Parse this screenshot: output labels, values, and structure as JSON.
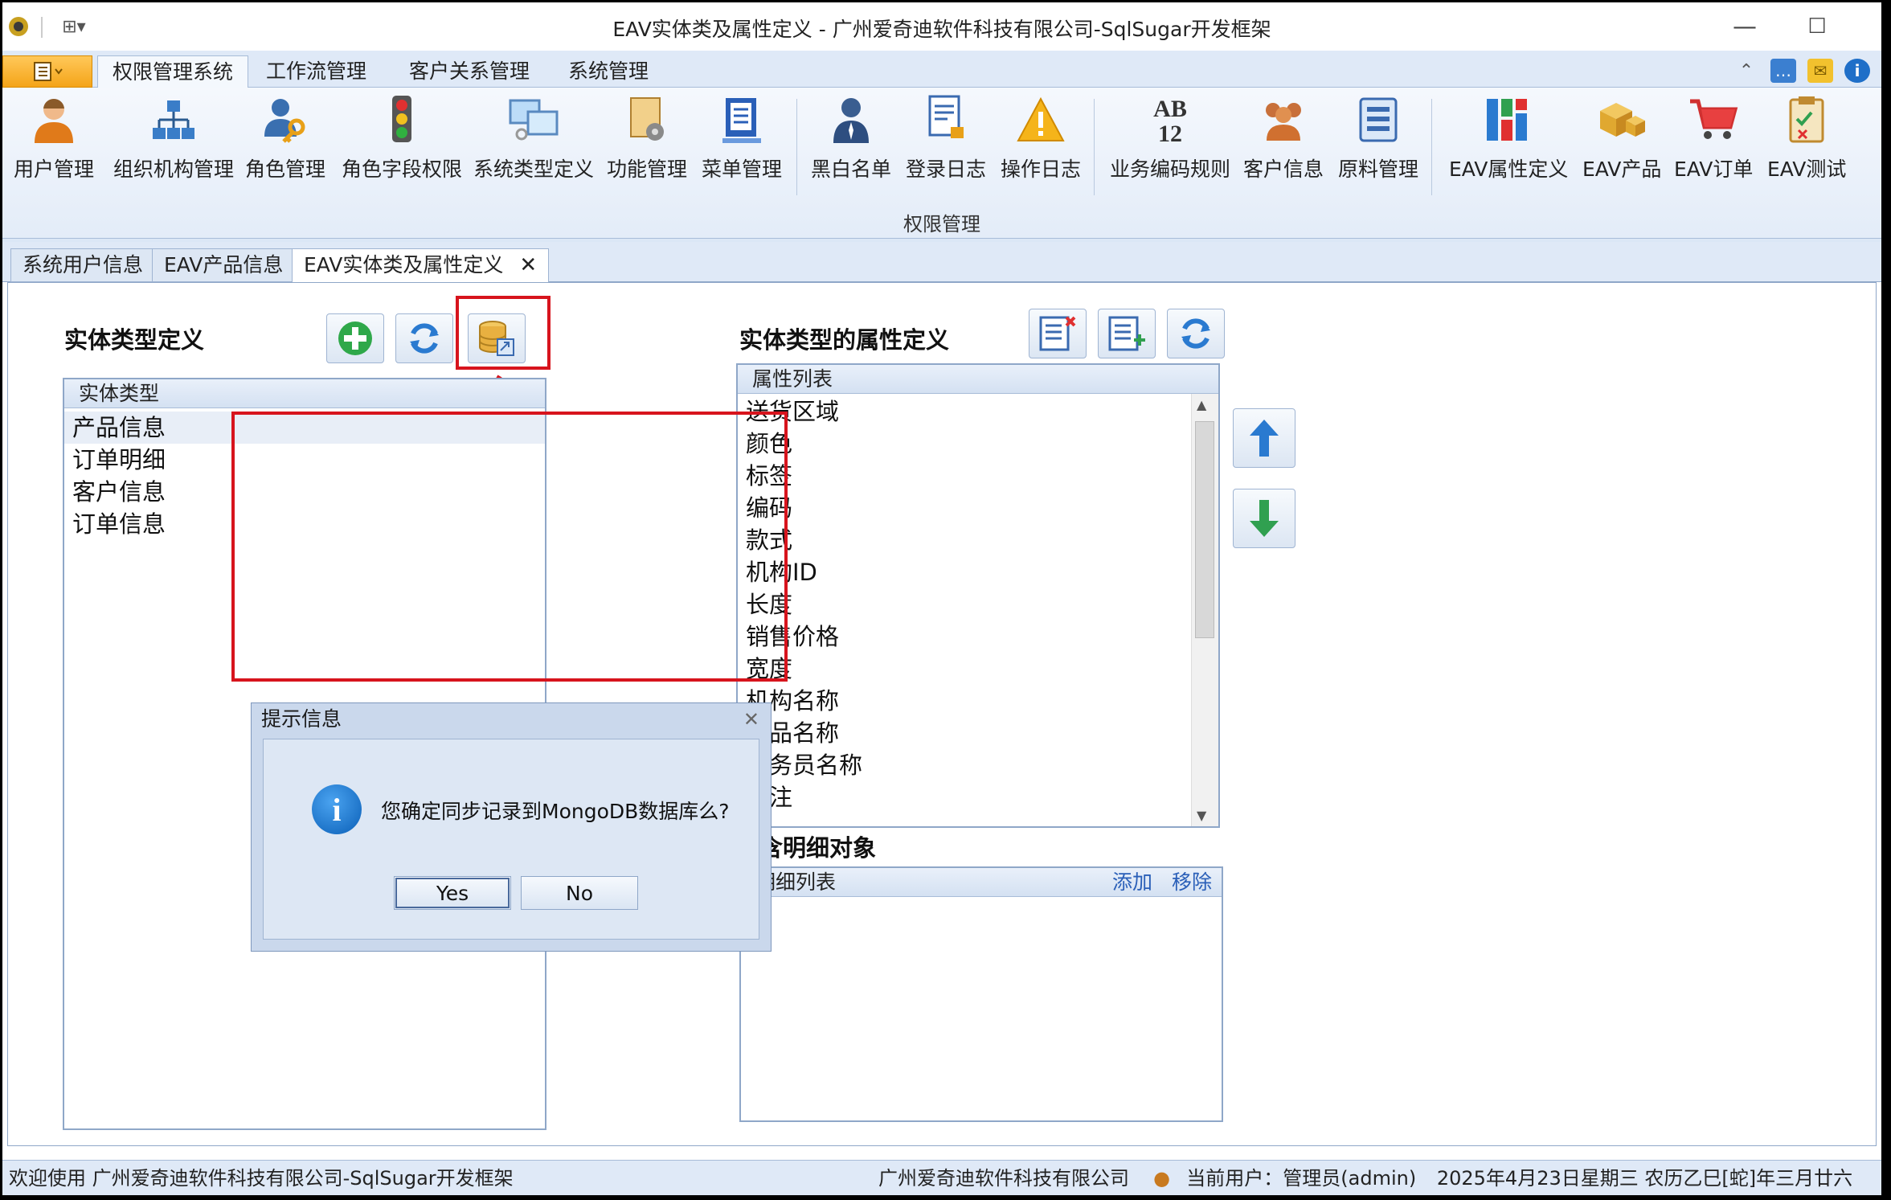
{
  "window": {
    "title": "EAV实体类及属性定义 - 广州爱奇迪软件科技有限公司-SqlSugar开发框架",
    "minimize": "—",
    "maximize": "☐",
    "close": "✕"
  },
  "ribbon": {
    "tabs": [
      "权限管理系统",
      "工作流管理",
      "客户关系管理",
      "系统管理"
    ],
    "active_tab": "权限管理系统",
    "group_label": "权限管理",
    "buttons": [
      {
        "label": "用户管理",
        "icon": "user-icon"
      },
      {
        "label": "组织机构管理",
        "icon": "org-chart-icon"
      },
      {
        "label": "角色管理",
        "icon": "role-key-icon"
      },
      {
        "label": "角色字段权限",
        "icon": "traffic-light-icon"
      },
      {
        "label": "系统类型定义",
        "icon": "monitors-icon"
      },
      {
        "label": "功能管理",
        "icon": "function-gear-icon"
      },
      {
        "label": "菜单管理",
        "icon": "menu-book-icon"
      },
      {
        "label": "黑白名单",
        "icon": "person-icon"
      },
      {
        "label": "登录日志",
        "icon": "login-log-icon"
      },
      {
        "label": "操作日志",
        "icon": "warning-icon"
      },
      {
        "label": "业务编码规则",
        "icon": "ab12-icon"
      },
      {
        "label": "客户信息",
        "icon": "customers-icon"
      },
      {
        "label": "原料管理",
        "icon": "material-list-icon"
      },
      {
        "label": "EAV属性定义",
        "icon": "eav-chart-icon"
      },
      {
        "label": "EAV产品",
        "icon": "boxes-icon"
      },
      {
        "label": "EAV订单",
        "icon": "cart-icon"
      },
      {
        "label": "EAV测试",
        "icon": "clipboard-check-icon"
      }
    ]
  },
  "doc_tabs": [
    {
      "label": "系统用户信息"
    },
    {
      "label": "EAV产品信息"
    },
    {
      "label": "EAV实体类及属性定义",
      "active": true,
      "close": "✕"
    }
  ],
  "left_panel": {
    "heading": "实体类型定义",
    "list_header": "实体类型",
    "items": [
      "产品信息",
      "订单明细",
      "客户信息",
      "订单信息"
    ],
    "selected": "产品信息"
  },
  "arrow_text": "------>",
  "right_panel": {
    "heading": "实体类型的属性定义",
    "list_header": "属性列表",
    "items": [
      "送货区域",
      "颜色",
      "标签",
      "编码",
      "款式",
      "机构ID",
      "长度",
      "销售价格",
      "宽度",
      "机构名称",
      "产品名称",
      "业务员名称",
      "备注"
    ],
    "detail_heading": "包含明细对象",
    "detail_header": "明细列表",
    "detail_add": "添加",
    "detail_remove": "移除"
  },
  "dialog": {
    "title": "提示信息",
    "message": "您确定同步记录到MongoDB数据库么?",
    "yes": "Yes",
    "no": "No",
    "close": "✕"
  },
  "statusbar": {
    "left": "欢迎使用 广州爱奇迪软件科技有限公司-SqlSugar开发框架",
    "company": "广州爱奇迪软件科技有限公司",
    "user": "当前用户：管理员(admin)",
    "date": "2025年4月23日星期三 农历乙巳[蛇]年三月廿六"
  },
  "colors": {
    "highlight_red": "#d7141d",
    "ribbon_bg": "#dfe9f7",
    "app_button": "#f4a418"
  }
}
